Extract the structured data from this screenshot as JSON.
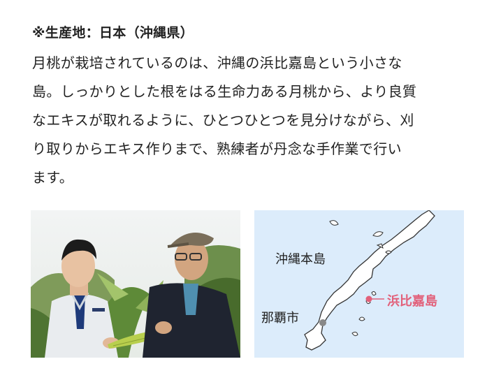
{
  "heading": "※生産地：日本（沖縄県）",
  "body_lines": [
    "月桃が栽培されているのは、沖縄の浜比嘉島という小さな",
    "島。しっかりとした根をはる生命力ある月桃から、より良質",
    "なエキスが取れるように、ひとつひとつを見分けながら、刈",
    "り取りからエキス作りまで、熟練者が丹念な手作業で行い",
    "ます。"
  ],
  "map": {
    "label_okinawa": "沖縄本島",
    "label_naha": "那覇市",
    "label_hamahiga": "浜比嘉島",
    "colors": {
      "sea": "#dcecfb",
      "land": "#ffffff",
      "coast": "#333333",
      "accent": "#e2607a",
      "naha_dot": "#888888"
    }
  }
}
